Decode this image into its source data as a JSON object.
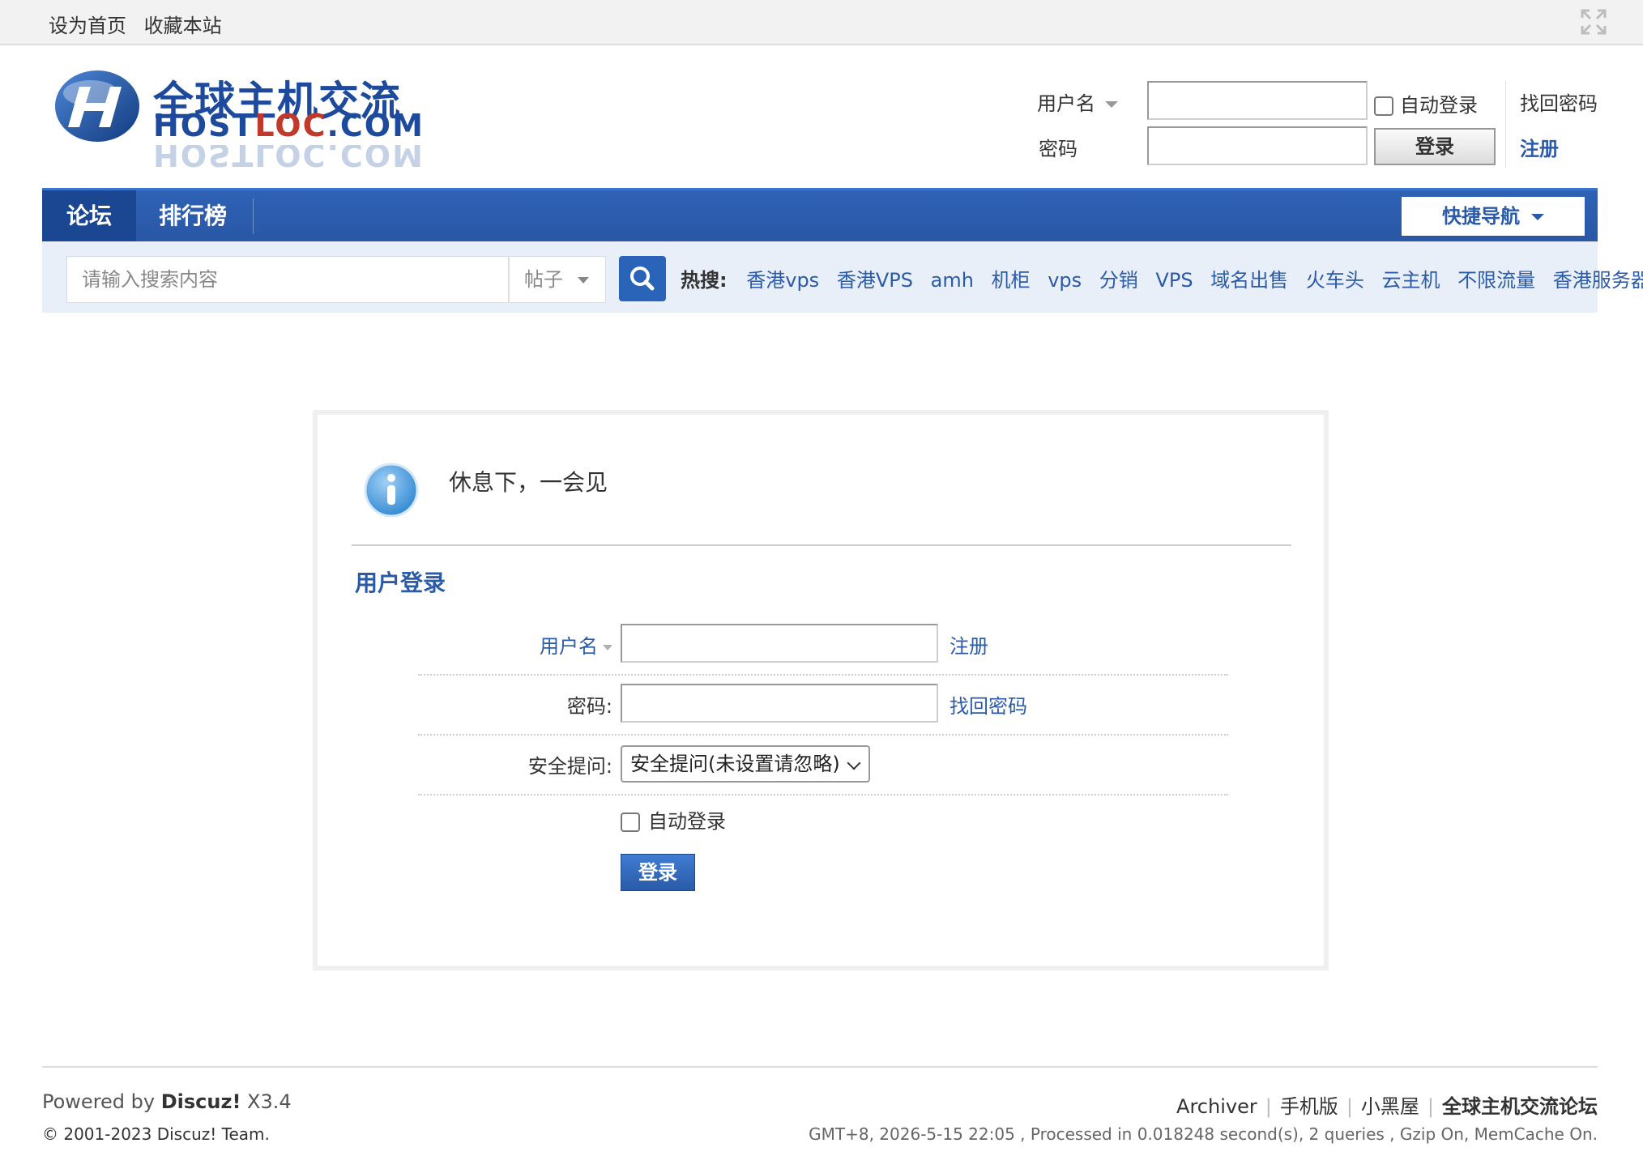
{
  "topbar": {
    "set_home": "设为首页",
    "bookmark": "收藏本站"
  },
  "logo": {
    "cn": "全球主机交流",
    "en_a": "HOST",
    "en_b": "LOC",
    "en_c": ".COM",
    "reflect": "HOSTLOC.COM"
  },
  "header_login": {
    "username_label": "用户名",
    "password_label": "密码",
    "auto_login": "自动登录",
    "login_button": "登录",
    "forgot_password": "找回密码",
    "register": "注册"
  },
  "nav": {
    "tabs": [
      {
        "label": "论坛"
      },
      {
        "label": "排行榜"
      }
    ],
    "quick_nav": "快捷导航"
  },
  "search": {
    "placeholder": "请输入搜索内容",
    "type": "帖子",
    "hot_label": "热搜:",
    "hot": [
      "香港vps",
      "香港VPS",
      "amh",
      "机柜",
      "vps",
      "分销",
      "VPS",
      "域名出售",
      "火车头",
      "云主机",
      "不限流量",
      "香港服务器"
    ]
  },
  "panel": {
    "message": "休息下，一会见",
    "title": "用户登录",
    "username_label": "用户名",
    "register": "注册",
    "password_label": "密码:",
    "forgot_password": "找回密码",
    "security_label": "安全提问:",
    "security_value": "安全提问(未设置请忽略)",
    "auto_login": "自动登录",
    "login_button": "登录"
  },
  "footer": {
    "powered_prefix": "Powered by ",
    "powered_brand": "Discuz!",
    "powered_version": " X3.4",
    "copyright": "© 2001-2023 Discuz! Team.",
    "links": [
      "Archiver",
      "手机版",
      "小黑屋"
    ],
    "site_name": "全球主机交流论坛",
    "stats": "GMT+8, 2026-5-15 22:05 , Processed in 0.018248 second(s), 2 queries , Gzip On, MemCache On."
  },
  "colors": {
    "brand_blue": "#2b5ba8",
    "nav_blue": "#2e62b5",
    "nav_active": "#1b4692",
    "search_bg": "#e8eff8"
  }
}
